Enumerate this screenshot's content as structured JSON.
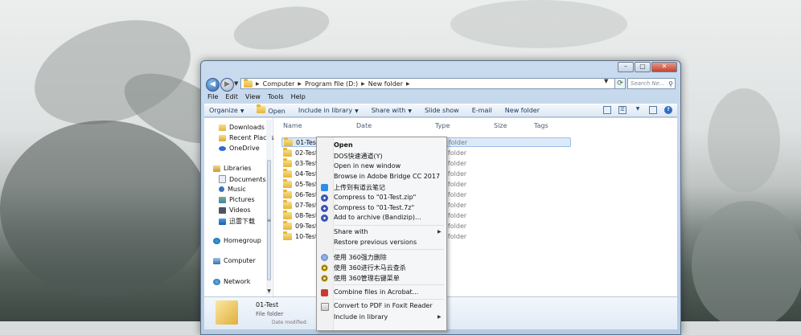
{
  "window": {
    "controls": {
      "minimize": "–",
      "maximize": "▢",
      "close": "✕"
    }
  },
  "address": {
    "back": "◀",
    "forward": "▶",
    "crumbs": [
      "Computer",
      "Program file (D:)",
      "New folder"
    ],
    "search_placeholder": "Search Ne..."
  },
  "menubar": [
    "File",
    "Edit",
    "View",
    "Tools",
    "Help"
  ],
  "toolbar": {
    "organize": "Organize",
    "open": "Open",
    "include_in_library": "Include in library",
    "share_with": "Share with",
    "slide_show": "Slide show",
    "email": "E-mail",
    "new_folder": "New folder"
  },
  "nav": {
    "downloads": "Downloads",
    "recent_places": "Recent Places",
    "onedrive": "OneDrive",
    "libraries": "Libraries",
    "documents": "Documents",
    "music": "Music",
    "pictures": "Pictures",
    "videos": "Videos",
    "xunlei": "迅雷下载",
    "homegroup": "Homegroup",
    "computer": "Computer",
    "network": "Network"
  },
  "columns": {
    "name": "Name",
    "date": "Date",
    "type": "Type",
    "size": "Size",
    "tags": "Tags"
  },
  "files": [
    {
      "name": "01-Test",
      "type": "File folder"
    },
    {
      "name": "02-Test",
      "type": "File folder"
    },
    {
      "name": "03-Test",
      "type": "File folder"
    },
    {
      "name": "04-Test",
      "type": "File folder"
    },
    {
      "name": "05-Test",
      "type": "File folder"
    },
    {
      "name": "06-Test",
      "type": "File folder"
    },
    {
      "name": "07-Test",
      "type": "File folder"
    },
    {
      "name": "08-Test",
      "type": "File folder"
    },
    {
      "name": "09-Test",
      "type": "File folder"
    },
    {
      "name": "10-Test",
      "type": "File folder"
    }
  ],
  "details": {
    "name": "01-Test",
    "type": "File folder",
    "modified": "Date modified:"
  },
  "context_menu": {
    "open": "Open",
    "dos": "DOS快速通道(Y)",
    "open_new_window": "Open in new window",
    "bridge": "Browse in Adobe Bridge CC 2017",
    "youdao": "上传到有道云笔记",
    "compress_zip": "Compress to \"01-Test.zip\"",
    "compress_7z": "Compress to \"01-Test.7z\"",
    "add_archive": "Add to archive (Bandizip)...",
    "share_with": "Share with",
    "restore": "Restore previous versions",
    "del360": "使用 360强力删除",
    "scan360": "使用 360进行木马云查杀",
    "manage360": "使用 360管理右键菜单",
    "acrobat": "Combine files in Acrobat...",
    "foxit": "Convert to PDF in Foxit Reader",
    "include_library": "Include in library"
  }
}
